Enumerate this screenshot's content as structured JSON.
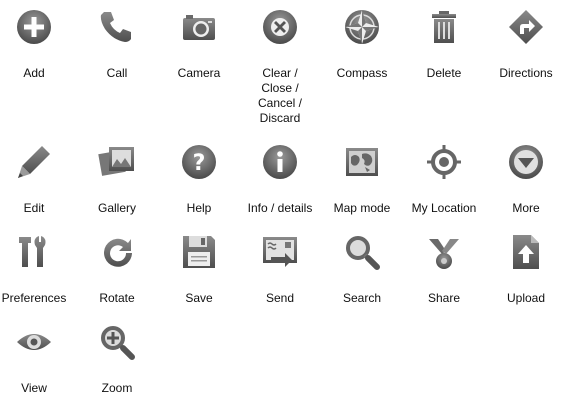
{
  "icons": {
    "add": "Add",
    "call": "Call",
    "camera": "Camera",
    "close": "Clear /\nClose /\nCancel /\nDiscard",
    "compass": "Compass",
    "delete": "Delete",
    "directions": "Directions",
    "edit": "Edit",
    "gallery": "Gallery",
    "help": "Help",
    "info": "Info / details",
    "mapmode": "Map mode",
    "mylocation": "My Location",
    "more": "More",
    "preferences": "Preferences",
    "rotate": "Rotate",
    "save": "Save",
    "send": "Send",
    "search": "Search",
    "share": "Share",
    "upload": "Upload",
    "view": "View",
    "zoom": "Zoom"
  },
  "colors": {
    "icon_dark": "#5a5a5a",
    "icon_light": "#a8a8a8",
    "label": "#111111"
  }
}
